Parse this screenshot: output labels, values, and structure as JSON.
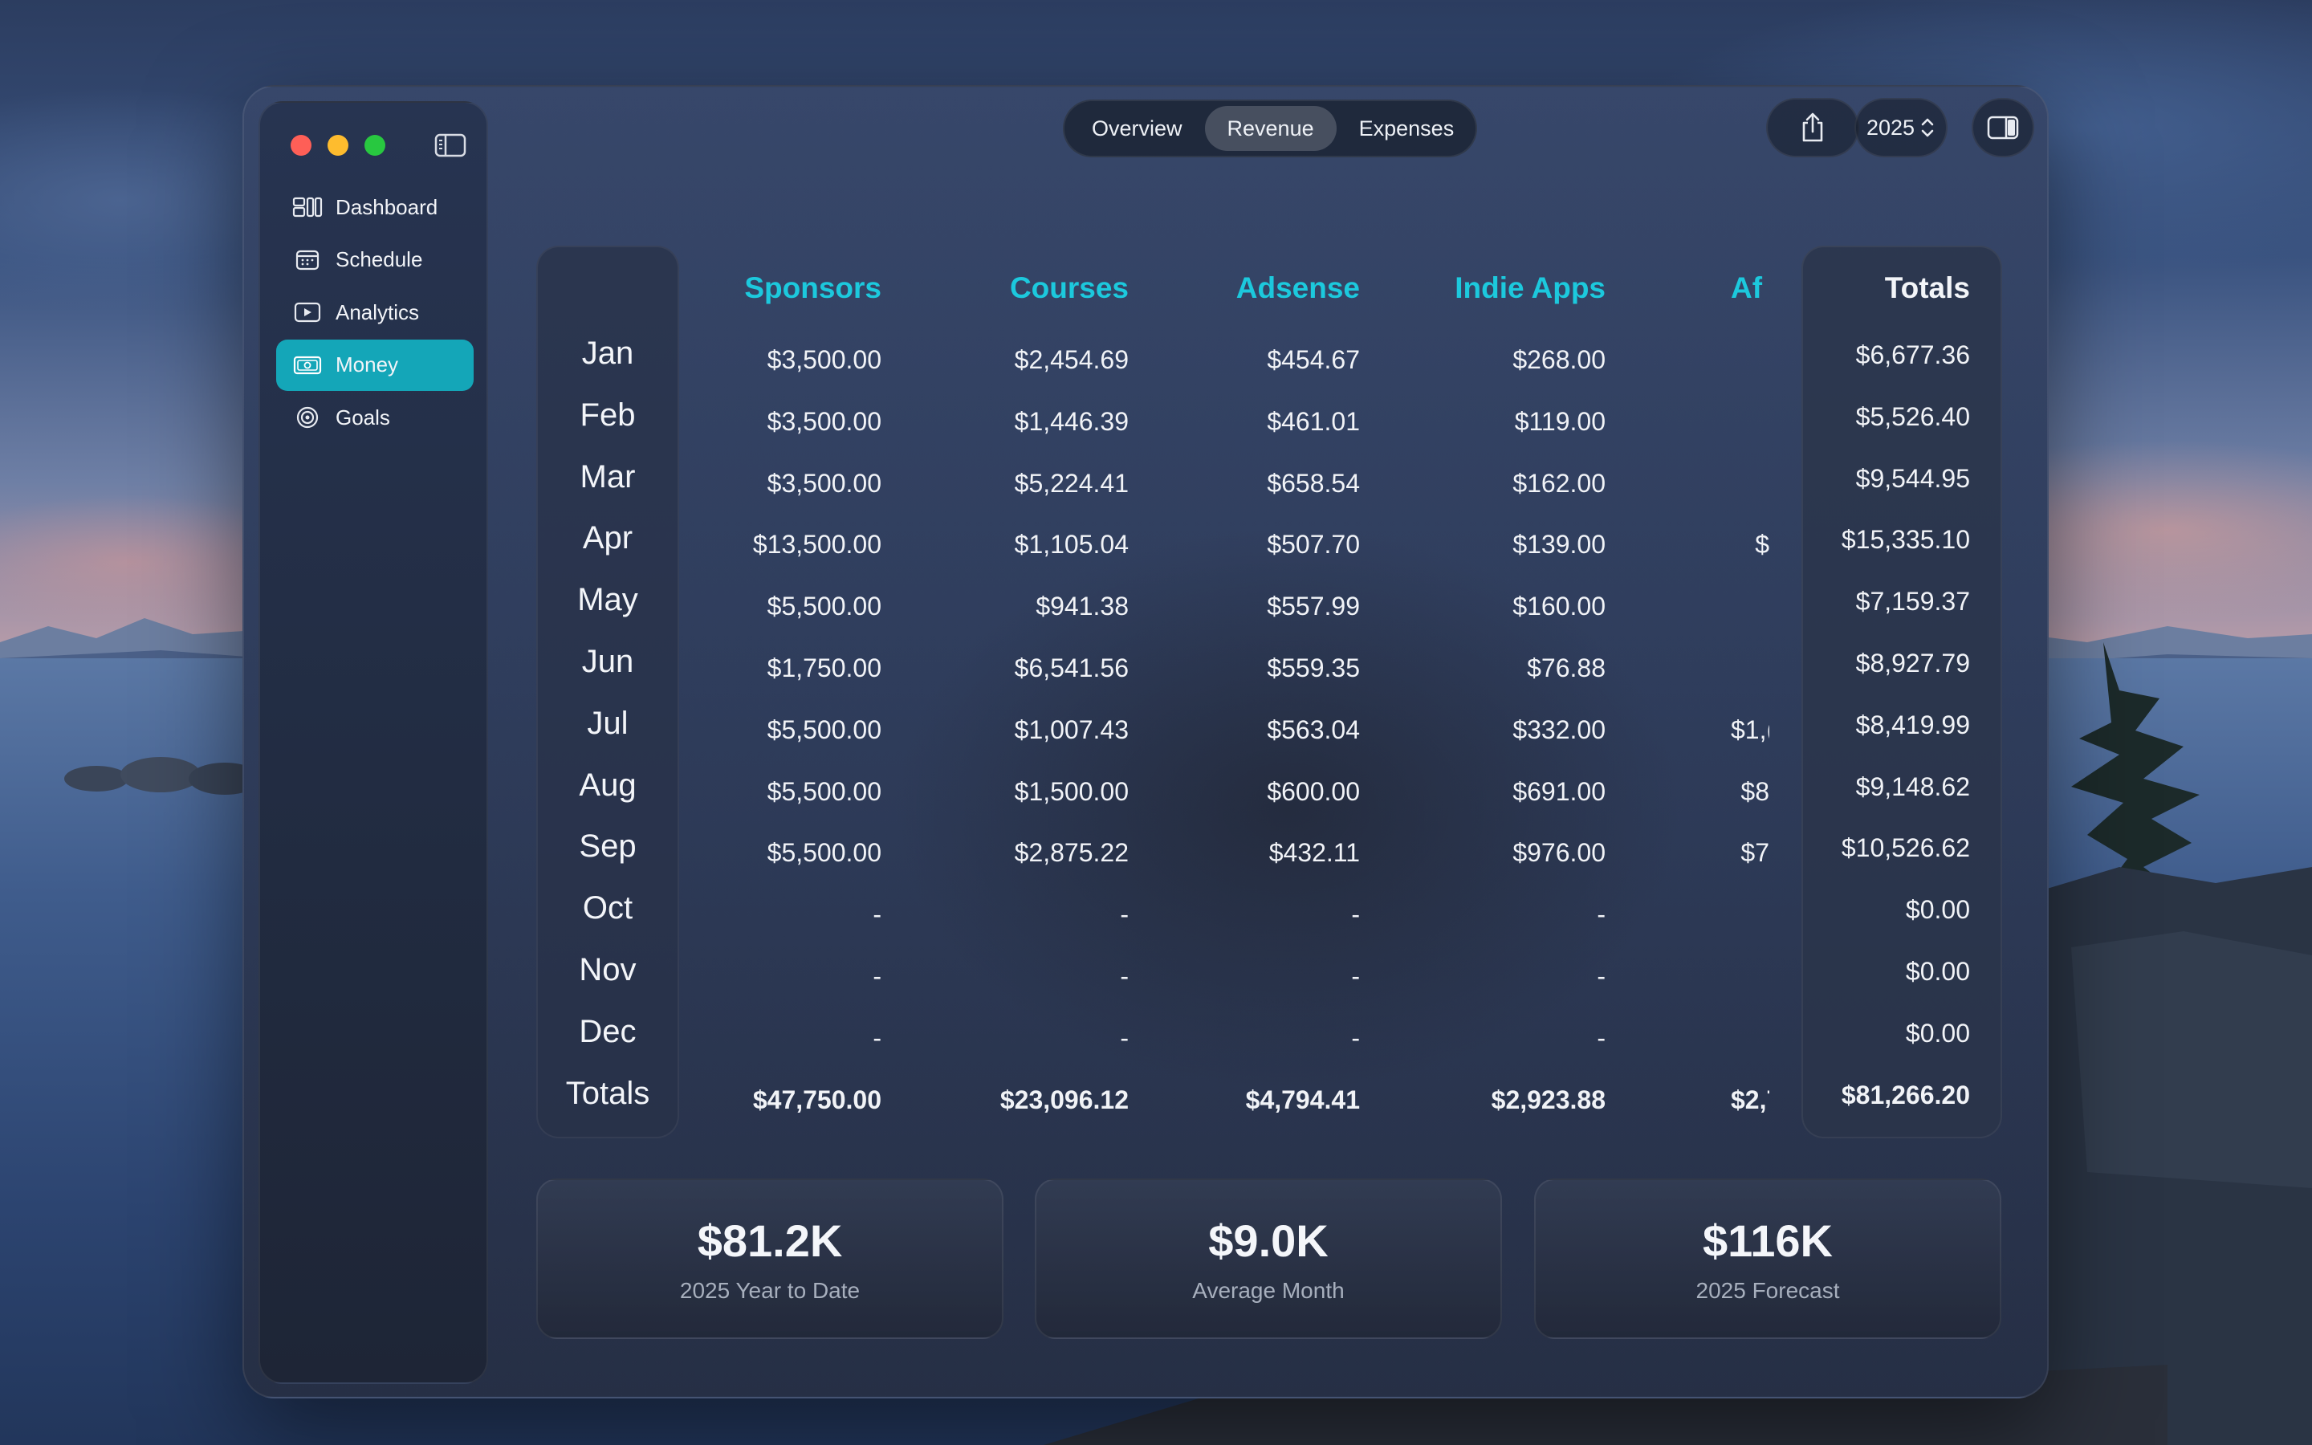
{
  "sidebar": {
    "items": [
      {
        "label": "Dashboard",
        "icon": "dashboard-icon"
      },
      {
        "label": "Schedule",
        "icon": "calendar-icon"
      },
      {
        "label": "Analytics",
        "icon": "play-icon"
      },
      {
        "label": "Money",
        "icon": "money-icon",
        "active": true
      },
      {
        "label": "Goals",
        "icon": "target-icon"
      }
    ]
  },
  "toolbar": {
    "tabs": [
      {
        "label": "Overview"
      },
      {
        "label": "Revenue",
        "selected": true
      },
      {
        "label": "Expenses"
      }
    ],
    "year": "2025",
    "share_icon": "share-icon",
    "inspector_icon": "sidebar-right-icon"
  },
  "colors": {
    "accent": "#14a6b8",
    "header_teal": "#1cc9dd"
  },
  "table": {
    "columns": [
      "Sponsors",
      "Courses",
      "Adsense",
      "Indie Apps",
      "Af",
      "Totals"
    ],
    "months": [
      "Jan",
      "Feb",
      "Mar",
      "Apr",
      "May",
      "Jun",
      "Jul",
      "Aug",
      "Sep",
      "Oct",
      "Nov",
      "Dec",
      "Totals"
    ],
    "rows": [
      [
        "$3,500.00",
        "$2,454.69",
        "$454.67",
        "$268.00",
        "",
        "$6,677.36"
      ],
      [
        "$3,500.00",
        "$1,446.39",
        "$461.01",
        "$119.00",
        "",
        "$5,526.40"
      ],
      [
        "$3,500.00",
        "$5,224.41",
        "$658.54",
        "$162.00",
        "",
        "$9,544.95"
      ],
      [
        "$13,500.00",
        "$1,105.04",
        "$507.70",
        "$139.00",
        "$",
        "$15,335.10"
      ],
      [
        "$5,500.00",
        "$941.38",
        "$557.99",
        "$160.00",
        "",
        "$7,159.37"
      ],
      [
        "$1,750.00",
        "$6,541.56",
        "$559.35",
        "$76.88",
        "",
        "$8,927.79"
      ],
      [
        "$5,500.00",
        "$1,007.43",
        "$563.04",
        "$332.00",
        "$1,(",
        "$8,419.99"
      ],
      [
        "$5,500.00",
        "$1,500.00",
        "$600.00",
        "$691.00",
        "$8",
        "$9,148.62"
      ],
      [
        "$5,500.00",
        "$2,875.22",
        "$432.11",
        "$976.00",
        "$7",
        "$10,526.62"
      ],
      [
        "-",
        "-",
        "-",
        "-",
        "",
        "$0.00"
      ],
      [
        "-",
        "-",
        "-",
        "-",
        "",
        "$0.00"
      ],
      [
        "-",
        "-",
        "-",
        "-",
        "",
        "$0.00"
      ],
      [
        "$47,750.00",
        "$23,096.12",
        "$4,794.41",
        "$2,923.88",
        "$2,7",
        "$81,266.20"
      ]
    ]
  },
  "stats": [
    {
      "value": "$81.2K",
      "label": "2025 Year to Date"
    },
    {
      "value": "$9.0K",
      "label": "Average Month"
    },
    {
      "value": "$116K",
      "label": "2025 Forecast"
    }
  ]
}
